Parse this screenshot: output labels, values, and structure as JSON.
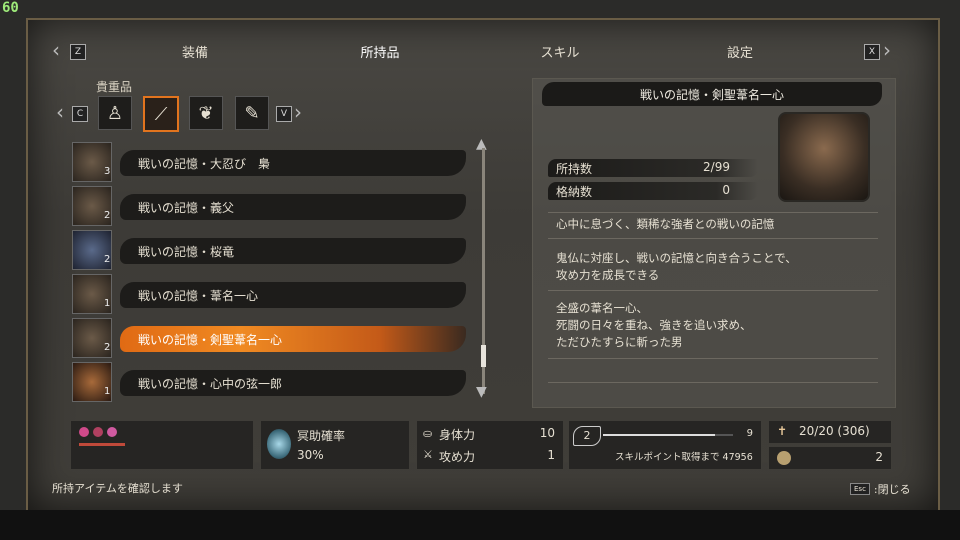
{
  "fps": "60",
  "tabs": [
    {
      "label": "装備",
      "active": false
    },
    {
      "label": "所持品",
      "active": true
    },
    {
      "label": "スキル",
      "active": false
    },
    {
      "label": "設定",
      "active": false
    }
  ],
  "keys": {
    "left_tab": "Z",
    "right_tab": "X",
    "left_cat": "C",
    "right_cat": "V"
  },
  "category_label": "貴重品",
  "category_icons": [
    "figure-icon",
    "blade-icon",
    "bird-icon",
    "feather-icon"
  ],
  "items": [
    {
      "name": "戦いの記憶・大忍び　梟",
      "count": "3",
      "selected": false
    },
    {
      "name": "戦いの記憶・義父",
      "count": "2",
      "selected": false
    },
    {
      "name": "戦いの記憶・桜竜",
      "count": "2",
      "selected": false
    },
    {
      "name": "戦いの記憶・葦名一心",
      "count": "1",
      "selected": false
    },
    {
      "name": "戦いの記憶・剣聖葦名一心",
      "count": "2",
      "selected": true
    },
    {
      "name": "戦いの記憶・心中の弦一郎",
      "count": "1",
      "selected": false
    }
  ],
  "detail": {
    "title": "戦いの記憶・剣聖葦名一心",
    "held_label": "所持数",
    "held_value": "2/99",
    "stored_label": "格納数",
    "stored_value": "0",
    "desc1": "心中に息づく、類稀な強者との戦いの記憶",
    "desc2a": "鬼仏に対座し、戦いの記憶と向き合うことで、",
    "desc2b": "攻め力を成長できる",
    "desc3a": "全盛の葦名一心、",
    "desc3b": "死闘の日々を重ね、強きを追い求め、",
    "desc3c": "ただひたすらに斬った男"
  },
  "status": {
    "unseen_aid_label": "冥助確率",
    "unseen_aid_value": "30%",
    "vitality_label": "身体力",
    "vitality_value": "10",
    "attack_label": "攻め力",
    "attack_value": "1",
    "skill_points": "2",
    "skill_gauge_level": "9",
    "skill_next_label": "スキルポイント取得まで",
    "skill_next_value": "47956",
    "skill_progress": 0.86,
    "currency": "20/20 (306)",
    "coins": "2"
  },
  "footer": {
    "hint": "所持アイテムを確認します",
    "esc_key": "Esc",
    "close_label": ":閉じる"
  },
  "colors": {
    "accent": "#f08a22",
    "bar_dark": "#1d1c1a"
  }
}
